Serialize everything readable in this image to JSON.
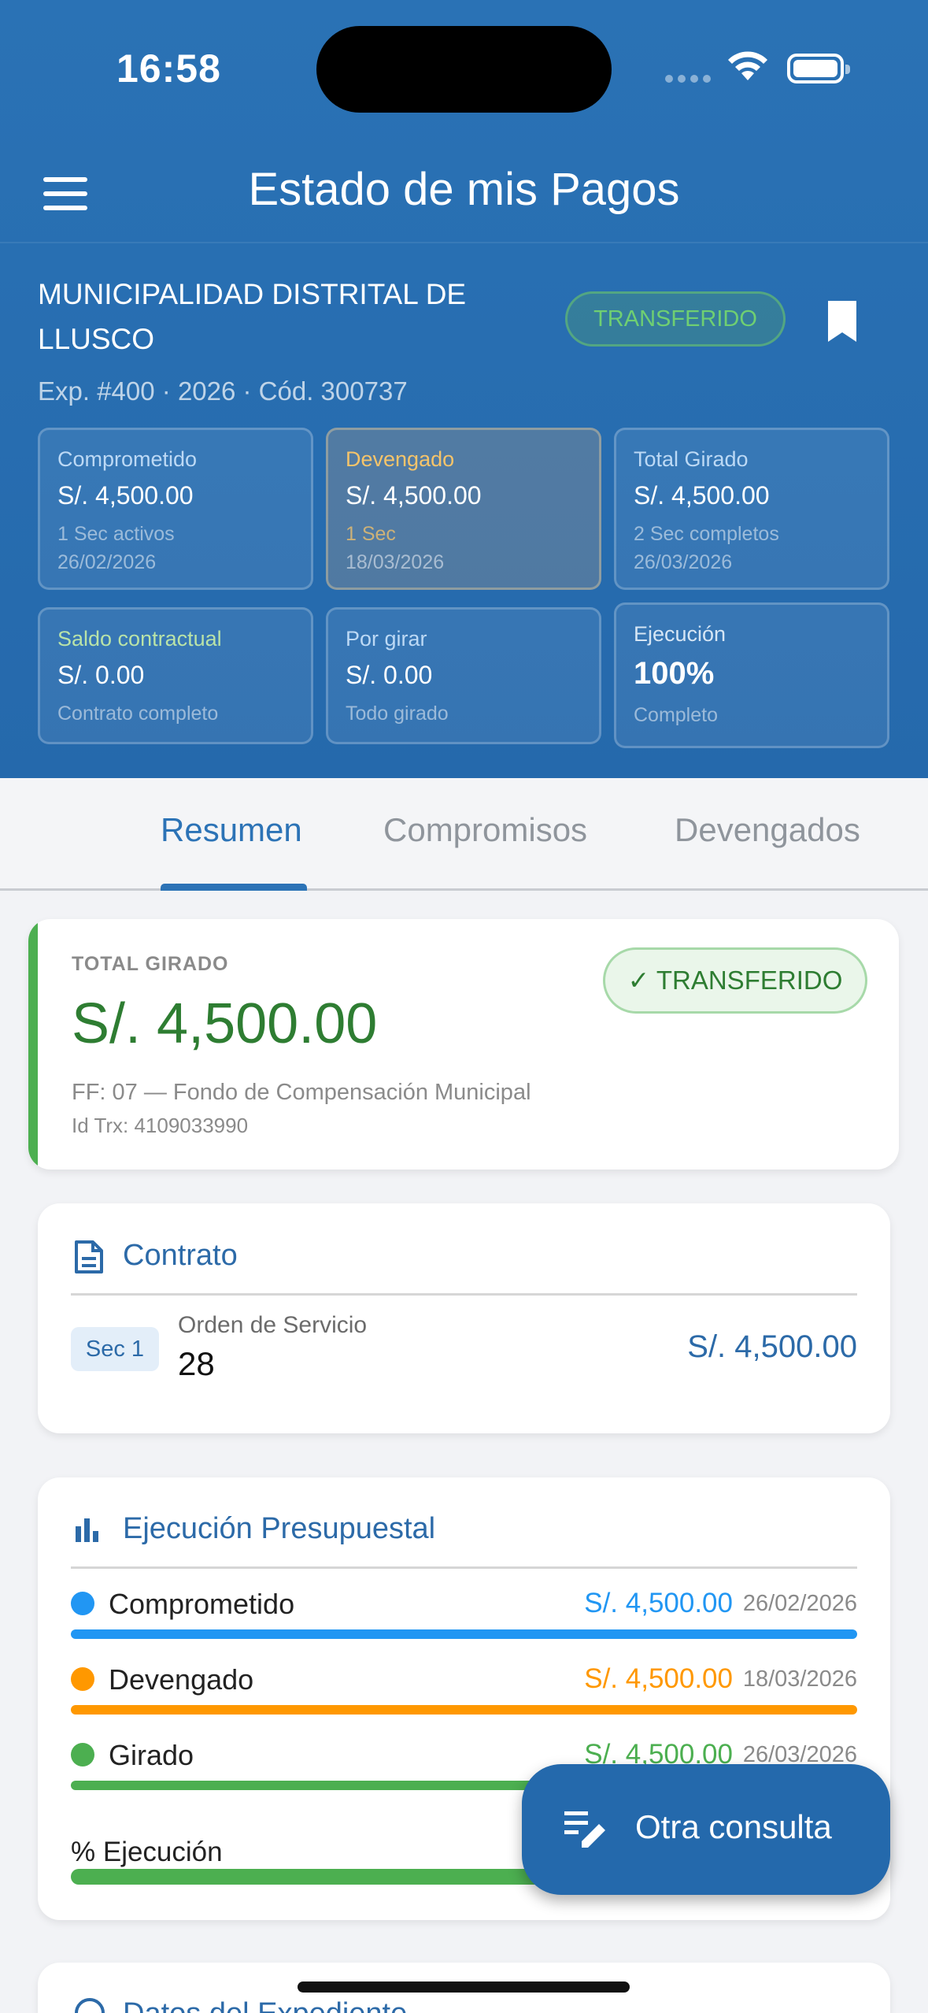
{
  "status_bar": {
    "time": "16:58"
  },
  "app_bar": {
    "title": "Estado de mis Pagos",
    "menu_icon": "menu-icon",
    "bookmark_icon": "bookmark-icon"
  },
  "entity": {
    "name": "MUNICIPALIDAD DISTRITAL DE LLUSCO",
    "status": "TRANSFERIDO",
    "meta": "Exp. #400 · 2026 · Cód. 300737"
  },
  "summary_cards": [
    {
      "label": "Comprometido",
      "value": "S/. 4,500.00",
      "sub1": "1 Sec activos",
      "sub2": "26/02/2026",
      "label_color": "#bcd9f5"
    },
    {
      "label": "Devengado",
      "value": "S/. 4,500.00",
      "sub1": "1 Sec",
      "sub2": "18/03/2026",
      "label_color": "#f6c46a"
    },
    {
      "label": "Total Girado",
      "value": "S/. 4,500.00",
      "sub1": "2 Sec completos",
      "sub2": "26/03/2026",
      "label_color": "#bcd9f5"
    },
    {
      "label": "Saldo contractual",
      "value": "S/. 0.00",
      "sub1": "Contrato completo",
      "label_color": "#b9e3a8"
    },
    {
      "label": "Por girar",
      "value": "S/. 0.00",
      "sub1": "Todo girado",
      "label_color": "#bcd9f5"
    },
    {
      "label": "Ejecución",
      "value": "100%",
      "sub1": "Completo",
      "label_color": "#d6e6f5"
    }
  ],
  "tabs": [
    "Resumen",
    "Compromisos",
    "Devengados"
  ],
  "total_card": {
    "label": "TOTAL GIRADO",
    "amount": "S/. 4,500.00",
    "status": "✓ TRANSFERIDO",
    "ff": "FF: 07 — Fondo de Compensación Municipal",
    "trx": "Id Trx: 4109033990"
  },
  "contract_card": {
    "title": "Contrato",
    "icon": "document-icon",
    "sec": "Sec 1",
    "type": "Orden de Servicio",
    "number": "28",
    "amount": "S/. 4,500.00"
  },
  "execution_card": {
    "title": "Ejecución Presupuestal",
    "icon": "bar-chart-icon",
    "rows": [
      {
        "label": "Comprometido",
        "amount": "S/. 4,500.00",
        "date": "26/02/2026",
        "color": "#2196f3",
        "fill": 1.0
      },
      {
        "label": "Devengado",
        "amount": "S/. 4,500.00",
        "date": "18/03/2026",
        "color": "#ff9800",
        "fill": 1.0
      },
      {
        "label": "Girado",
        "amount": "S/. 4,500.00",
        "date": "26/03/2026",
        "color": "#4caf50",
        "fill": 1.0
      }
    ],
    "pct_label": "% Ejecución",
    "pct_fill": 1.0
  },
  "next_card": {
    "title": "Datos del Expediente"
  },
  "fab": {
    "label": "Otra consulta",
    "icon": "edit-note-icon"
  }
}
